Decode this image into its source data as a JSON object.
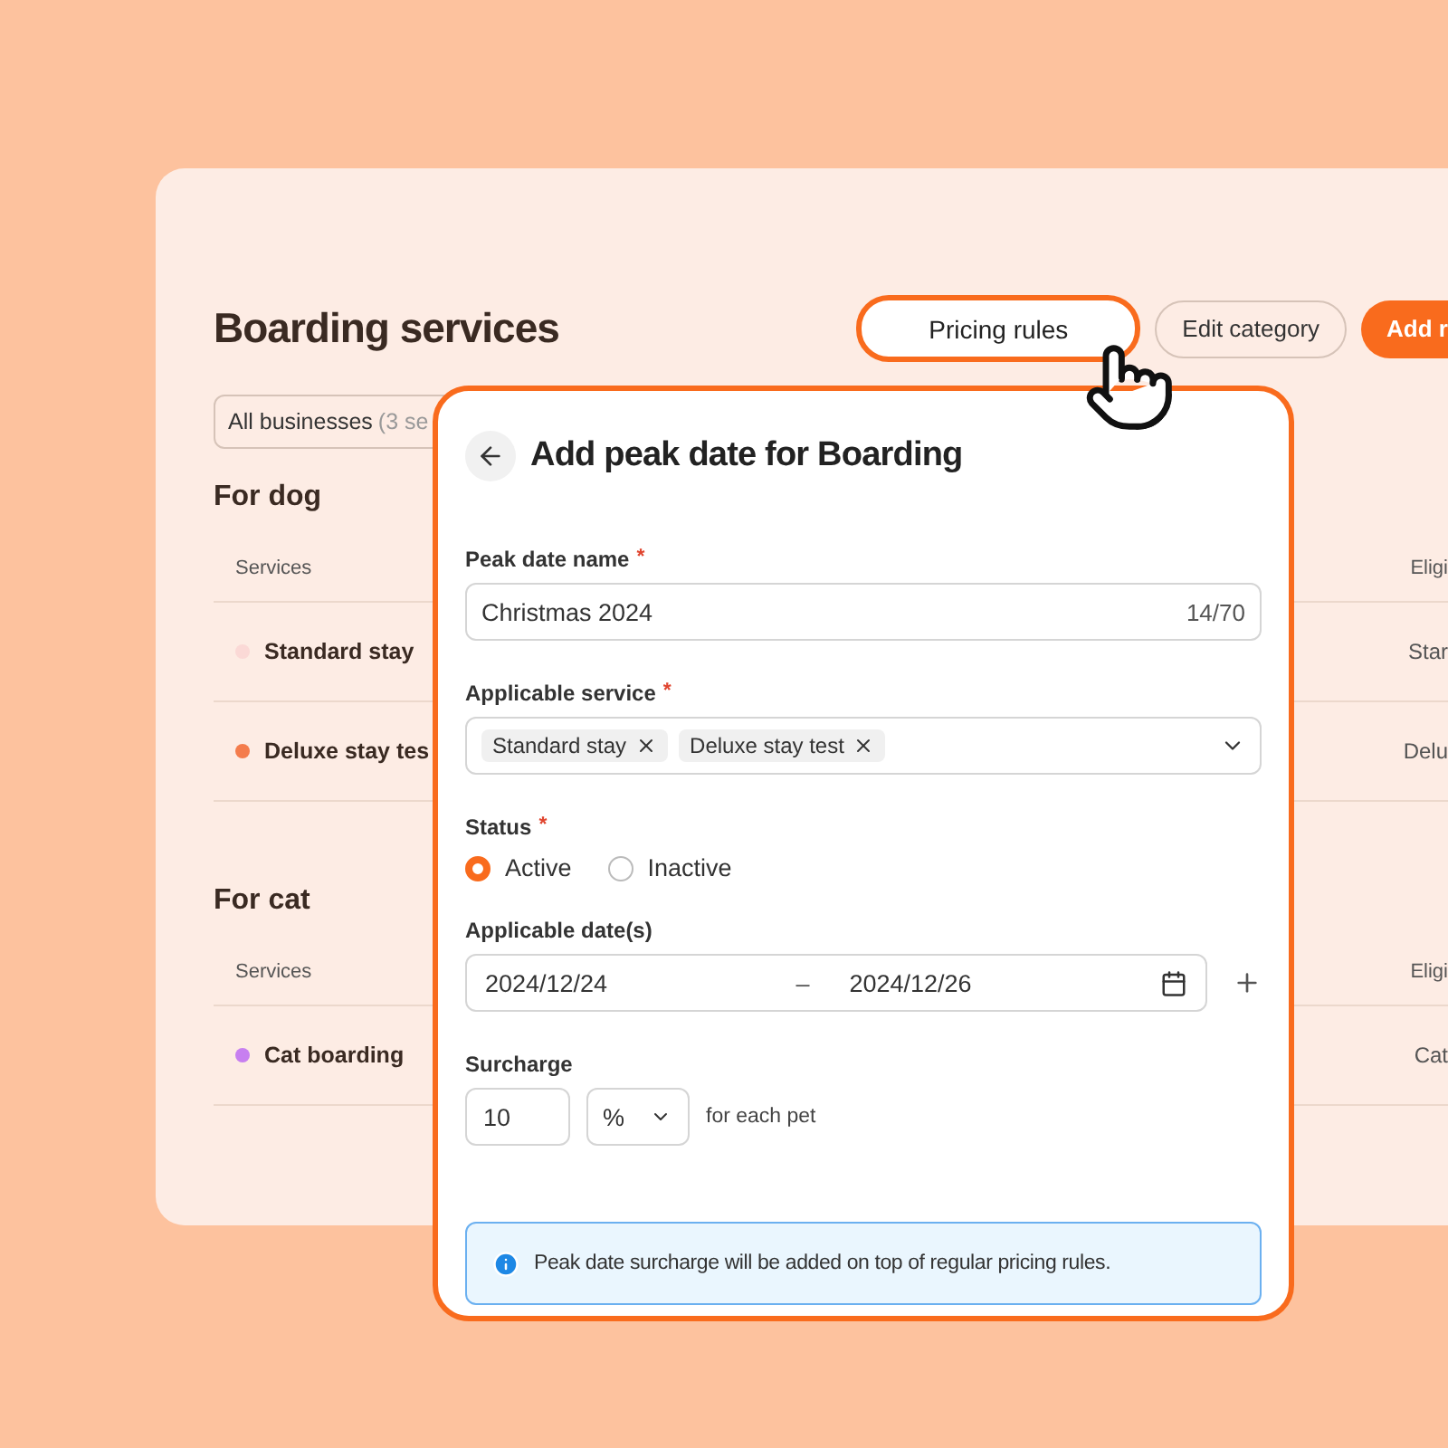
{
  "page": {
    "title": "Boarding services",
    "buttons": [
      {
        "label": "Pricing rules",
        "kind": "highlighted"
      },
      {
        "label": "Edit category",
        "kind": "outline"
      },
      {
        "label": "Add r",
        "kind": "primary"
      }
    ],
    "filter": {
      "value": "All businesses",
      "hint": "(3 se"
    },
    "sections": [
      {
        "title": "For dog",
        "columns": [
          "Services",
          "Eligi"
        ],
        "rows": [
          {
            "name": "Standard stay",
            "color": "#fbd9d6",
            "column_2": "Star"
          },
          {
            "name": "Deluxe stay tes",
            "color": "#f47c4c",
            "column_2": "Delu"
          }
        ]
      },
      {
        "title": "For cat",
        "columns": [
          "Services",
          "Eligi"
        ],
        "rows": [
          {
            "name": "Cat boarding",
            "color": "#c77ff0",
            "column_2": "Cat"
          }
        ]
      }
    ]
  },
  "dialog": {
    "title": "Add peak date for Boarding",
    "name_field": {
      "label": "Peak date name",
      "required_mark": "*",
      "value": "Christmas 2024",
      "counter": "14/70"
    },
    "service_field": {
      "label": "Applicable service",
      "required_mark": "*",
      "tags": [
        "Standard stay",
        "Deluxe stay test"
      ]
    },
    "status": {
      "label": "Status",
      "required_mark": "*",
      "options": [
        {
          "label": "Active",
          "selected": true
        },
        {
          "label": "Inactive",
          "selected": false
        }
      ]
    },
    "dates": {
      "label": "Applicable date(s)",
      "start": "2024/12/24",
      "separator": "–",
      "end": "2024/12/26"
    },
    "surcharge": {
      "label": "Surcharge",
      "value": "10",
      "unit": "%",
      "suffix": "for each pet"
    },
    "notice": "Peak date surcharge will be added on top of regular pricing rules."
  }
}
